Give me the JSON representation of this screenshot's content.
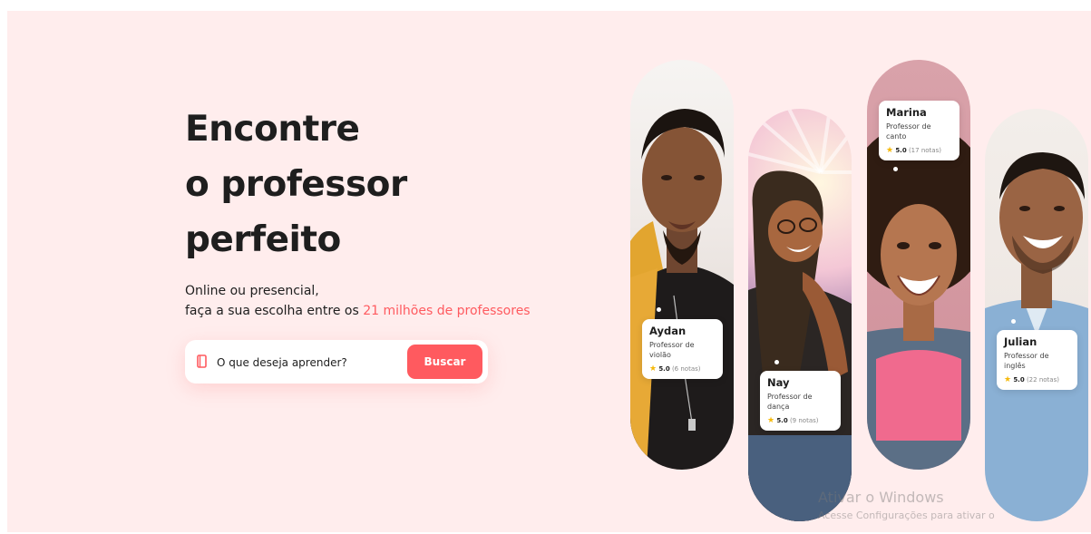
{
  "hero": {
    "headline": [
      "Encontre",
      "o professor",
      "perfeito"
    ],
    "subline_1": "Online ou presencial,",
    "subline_2_prefix": "faça a sua escolha entre os ",
    "subline_2_highlight": "21 milhões de professores"
  },
  "search": {
    "placeholder": "O que deseja aprender?",
    "button_label": "Buscar",
    "icon": "book-icon"
  },
  "teachers": [
    {
      "name": "Aydan",
      "role": "Professor de violão",
      "score": "5.0",
      "reviews": "(6 notas)"
    },
    {
      "name": "Nay",
      "role": "Professor de dança",
      "score": "5.0",
      "reviews": "(9 notas)"
    },
    {
      "name": "Marina",
      "role": "Professor de canto",
      "score": "5.0",
      "reviews": "(17 notas)"
    },
    {
      "name": "Julian",
      "role": "Professor de inglês",
      "score": "5.0",
      "reviews": "(22 notas)"
    }
  ],
  "watermark": {
    "title": "Ativar o Windows",
    "subtitle": "Acesse Configurações para ativar o"
  },
  "colors": {
    "accent": "#ff5a5f",
    "background": "#ffeded",
    "text": "#1e1e1e"
  }
}
